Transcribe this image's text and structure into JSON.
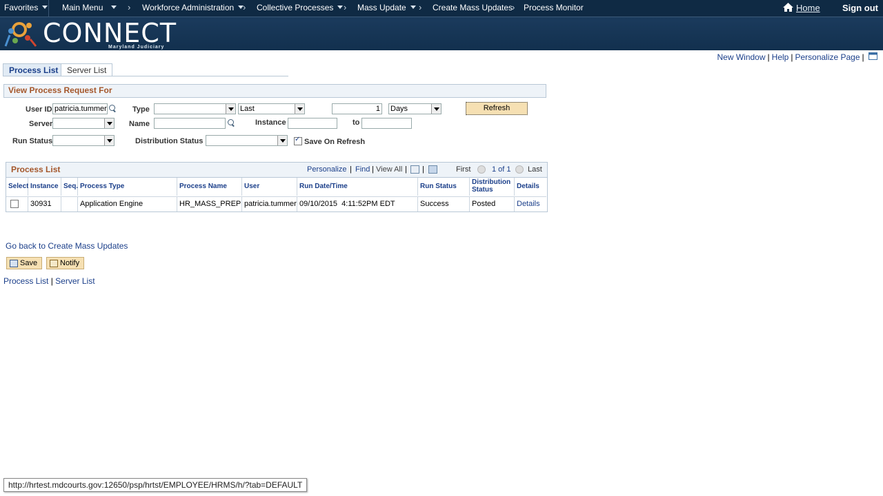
{
  "topnav": {
    "favorites": "Favorites",
    "main_menu": "Main Menu",
    "crumbs": [
      "Workforce Administration",
      "Collective Processes",
      "Mass Update",
      "Create Mass Updates",
      "Process Monitor"
    ],
    "home": "Home",
    "signout": "Sign out"
  },
  "banner": {
    "logo": "CONNECT",
    "sub": "Maryland Judiciary"
  },
  "pagelinks": {
    "new_window": "New Window",
    "help": "Help",
    "personalize": "Personalize Page"
  },
  "tabs": {
    "process_list": "Process List",
    "server_list": "Server List"
  },
  "filter": {
    "title": "View Process Request For",
    "user_id_label": "User ID",
    "user_id_value": "patricia.tummer",
    "type_label": "Type",
    "type_value": "",
    "last_value": "Last",
    "count_value": "1",
    "days_value": "Days",
    "refresh": "Refresh",
    "server_label": "Server",
    "server_value": "",
    "name_label": "Name",
    "name_value": "",
    "instance_label": "Instance",
    "instance_from": "",
    "to_label": "to",
    "instance_to": "",
    "run_status_label": "Run Status",
    "run_status_value": "",
    "dist_status_label": "Distribution Status",
    "dist_status_value": "",
    "save_on_refresh": "Save On Refresh"
  },
  "grid": {
    "title": "Process List",
    "personalize": "Personalize",
    "find": "Find",
    "view_all": "View All",
    "first": "First",
    "page": "1 of 1",
    "last": "Last",
    "columns": [
      "Select",
      "Instance",
      "Seq.",
      "Process Type",
      "Process Name",
      "User",
      "Run Date/Time",
      "Run Status",
      "Distribution Status",
      "Details"
    ],
    "row": {
      "instance": "30931",
      "seq": "",
      "process_type": "Application Engine",
      "process_name": "HR_MASS_PREP",
      "user": "patricia.tummer",
      "run_datetime": "09/10/2015  4:11:52PM EDT",
      "run_status": "Success",
      "dist_status": "Posted",
      "details": "Details"
    }
  },
  "go_back": "Go back to Create Mass Updates",
  "buttons": {
    "save": "Save",
    "notify": "Notify"
  },
  "bottom_links": {
    "process_list": "Process List",
    "server_list": "Server List"
  },
  "statusbar": "http://hrtest.mdcourts.gov:12650/psp/hrtst/EMPLOYEE/HRMS/h/?tab=DEFAULT",
  "colors": {
    "nav_bg": "#0f2a44",
    "accent": "#a4562a",
    "link": "#1b3f8a",
    "button_bg": "#f6e0b3"
  }
}
